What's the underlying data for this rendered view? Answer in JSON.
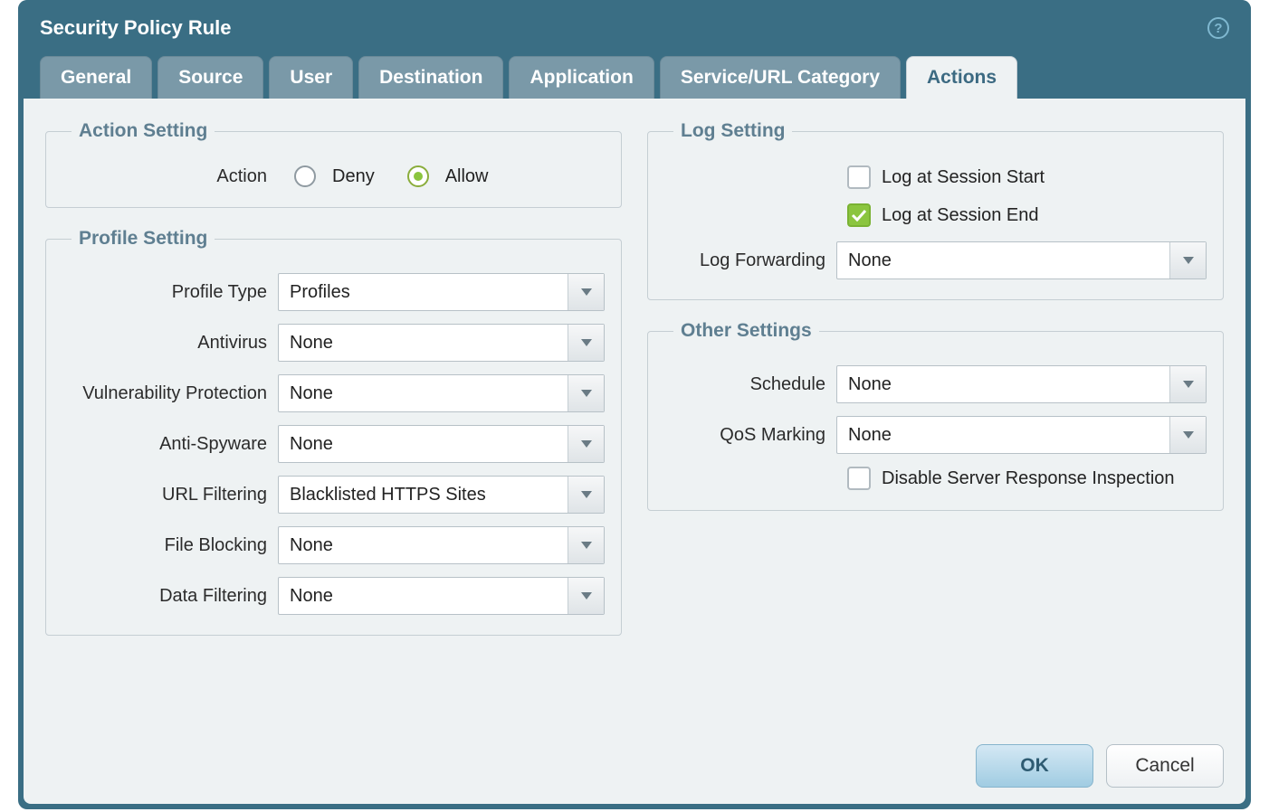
{
  "dialog": {
    "title": "Security Policy Rule"
  },
  "tabs": {
    "general": "General",
    "source": "Source",
    "user": "User",
    "destination": "Destination",
    "application": "Application",
    "service_url": "Service/URL Category",
    "actions": "Actions"
  },
  "groups": {
    "action_setting": "Action Setting",
    "profile_setting": "Profile Setting",
    "log_setting": "Log Setting",
    "other_settings": "Other Settings"
  },
  "action_setting": {
    "label": "Action",
    "deny": "Deny",
    "allow": "Allow",
    "selected": "allow"
  },
  "profile_setting": {
    "profile_type": {
      "label": "Profile Type",
      "value": "Profiles"
    },
    "antivirus": {
      "label": "Antivirus",
      "value": "None"
    },
    "vuln_protection": {
      "label": "Vulnerability Protection",
      "value": "None"
    },
    "anti_spyware": {
      "label": "Anti-Spyware",
      "value": "None"
    },
    "url_filtering": {
      "label": "URL Filtering",
      "value": "Blacklisted HTTPS Sites"
    },
    "file_blocking": {
      "label": "File Blocking",
      "value": "None"
    },
    "data_filtering": {
      "label": "Data Filtering",
      "value": "None"
    }
  },
  "log_setting": {
    "log_start": {
      "label": "Log at Session Start",
      "checked": false
    },
    "log_end": {
      "label": "Log at Session End",
      "checked": true
    },
    "log_forwarding": {
      "label": "Log Forwarding",
      "value": "None"
    }
  },
  "other_settings": {
    "schedule": {
      "label": "Schedule",
      "value": "None"
    },
    "qos_marking": {
      "label": "QoS Marking",
      "value": "None"
    },
    "disable_sri": {
      "label": "Disable Server Response Inspection",
      "checked": false
    }
  },
  "buttons": {
    "ok": "OK",
    "cancel": "Cancel"
  }
}
